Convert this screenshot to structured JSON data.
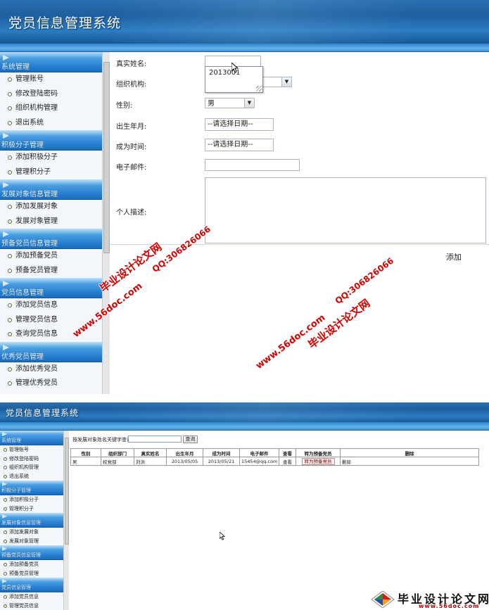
{
  "top": {
    "title": "党员信息管理系统",
    "sidebar": [
      {
        "title": "系统管理",
        "items": [
          "管理账号",
          "修改登陆密码",
          "组织机构管理",
          "退出系统"
        ]
      },
      {
        "title": "积极分子管理",
        "items": [
          "添加积极分子",
          "管理积分子"
        ]
      },
      {
        "title": "发展对象信息管理",
        "items": [
          "添加发展对象",
          "发展对象管理"
        ]
      },
      {
        "title": "预备党员信息管理",
        "items": [
          "添加预备党员",
          "预备党员管理"
        ]
      },
      {
        "title": "党员信息管理",
        "items": [
          "添加党员信息",
          "管理党员信息",
          "查询党员信息"
        ]
      },
      {
        "title": "优秀党员管理",
        "items": [
          "添加优秀党员",
          "管理优秀党员"
        ]
      }
    ],
    "form": {
      "name_label": "真实姓名:",
      "name_value": "",
      "autocomplete_option": "2013001",
      "org_label": "组织机构:",
      "org_value": "",
      "gender_label": "性别:",
      "gender_value": "男",
      "birth_label": "出生年月:",
      "birth_value": "--请选择日期--",
      "join_label": "成为时间:",
      "join_value": "--请选择日期--",
      "email_label": "电子邮件:",
      "email_value": "",
      "desc_label": "个人描述:",
      "desc_value": "",
      "submit_label": "添加"
    }
  },
  "bottom": {
    "title": "党员信息管理系统",
    "sidebar": [
      {
        "title": "系统管理",
        "items": [
          "管理账号",
          "修改登陆密码",
          "组织机构管理",
          "退出系统"
        ]
      },
      {
        "title": "积极分子管理",
        "items": [
          "添加积极分子",
          "管理积分子"
        ]
      },
      {
        "title": "发展对象信息管理",
        "items": [
          "添加发展对象",
          "发展对象管理"
        ]
      },
      {
        "title": "预备党员信息管理",
        "items": [
          "添加预备党员",
          "预备党员管理"
        ]
      },
      {
        "title": "党员信息管理",
        "items": [
          "添加党员信息",
          "管理党员信息"
        ]
      }
    ],
    "search": {
      "label": "按发展对象姓名关键字查询:",
      "value": "",
      "button": "查询"
    },
    "table": {
      "headers": [
        "性别",
        "组织部门",
        "真实姓名",
        "出生年月",
        "成为时间",
        "电子邮件",
        "查看",
        "转为预备党员",
        "删除"
      ],
      "rows": [
        [
          "男",
          "校党部",
          "刘洪",
          "2013/05/05",
          "2013/05/21",
          "15454@qq.com",
          "查看",
          "转为预备党员",
          "删除"
        ]
      ]
    }
  },
  "watermark": {
    "site": "毕业设计论文网",
    "url": "www.56doc.com",
    "qq": "QQ:306826066"
  },
  "logo": {
    "name": "毕业设计论文网",
    "url": "www.56doc.com"
  },
  "colors": {
    "header_blue": "#1d5f9f",
    "section_blue": "#2a80d0",
    "watermark_red": "#d50000"
  }
}
